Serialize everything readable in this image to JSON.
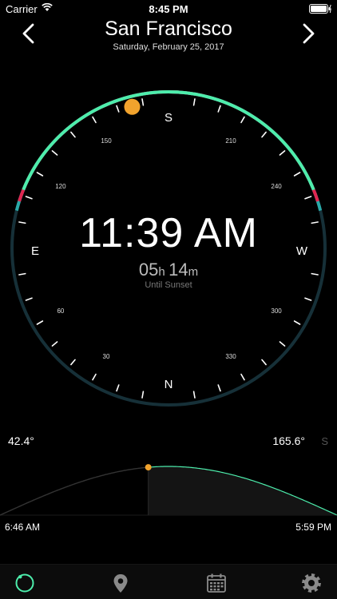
{
  "status_bar": {
    "carrier": "Carrier",
    "time": "8:45 PM"
  },
  "header": {
    "city": "San Francisco",
    "date": "Saturday, February 25, 2017"
  },
  "dial": {
    "cardinals": {
      "north": "N",
      "south": "S",
      "east": "E",
      "west": "W"
    },
    "degree_labels": [
      "30",
      "60",
      "120",
      "150",
      "210",
      "240",
      "300",
      "330"
    ],
    "current_time": "11:39 AM",
    "countdown": {
      "hours": "05",
      "hours_unit": "h",
      "minutes": "14",
      "minutes_unit": "m",
      "label": "Until Sunset"
    },
    "sun_azimuth_deg": 165.6,
    "colors": {
      "daylight": "#4dedac",
      "twilight": "#e02650",
      "dusk": "#2aa9a8",
      "night": "#163038",
      "sun": "#f1a32d"
    }
  },
  "sun_path": {
    "altitude": "42.4°",
    "azimuth": "165.6°",
    "azimuth_direction": "S",
    "sunrise": "6:46 AM",
    "sunset": "5:59 PM",
    "day_progress": 0.44
  },
  "tab_bar": {
    "icons": [
      "dial-icon",
      "location-pin-icon",
      "calendar-icon",
      "gear-icon"
    ]
  }
}
